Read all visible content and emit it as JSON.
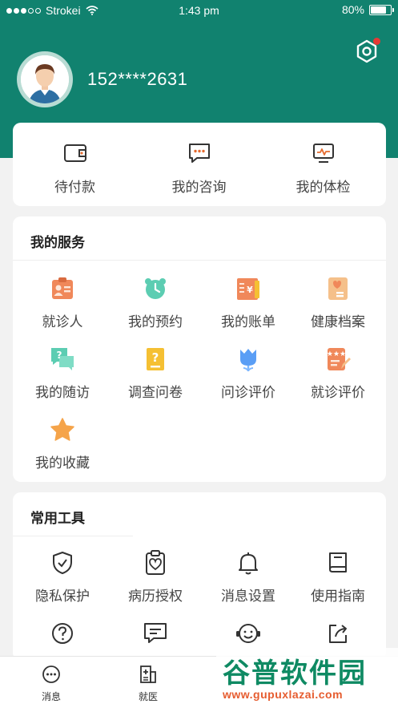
{
  "status_bar": {
    "carrier": "Strokei",
    "time": "1:43 pm",
    "battery": "80%",
    "battery_level": 0.8
  },
  "profile": {
    "phone": "152****2631"
  },
  "quick_actions": [
    {
      "label": "待付款",
      "icon": "wallet-icon"
    },
    {
      "label": "我的咨询",
      "icon": "chat-bubble-icon"
    },
    {
      "label": "我的体检",
      "icon": "monitor-pulse-icon"
    }
  ],
  "services": {
    "title": "我的服务",
    "items": [
      {
        "label": "就诊人",
        "icon": "id-card-icon"
      },
      {
        "label": "我的预约",
        "icon": "alarm-clock-icon"
      },
      {
        "label": "我的账单",
        "icon": "bill-icon"
      },
      {
        "label": "健康档案",
        "icon": "health-file-icon"
      },
      {
        "label": "我的随访",
        "icon": "question-chat-icon"
      },
      {
        "label": "调查问卷",
        "icon": "survey-icon"
      },
      {
        "label": "问诊评价",
        "icon": "tulip-icon"
      },
      {
        "label": "就诊评价",
        "icon": "review-pen-icon"
      },
      {
        "label": "我的收藏",
        "icon": "star-icon"
      }
    ]
  },
  "tools": {
    "title": "常用工具",
    "items": [
      {
        "label": "隐私保护",
        "icon": "shield-check-icon"
      },
      {
        "label": "病历授权",
        "icon": "clipboard-heart-icon"
      },
      {
        "label": "消息设置",
        "icon": "bell-icon"
      },
      {
        "label": "使用指南",
        "icon": "book-icon"
      },
      {
        "label": "",
        "icon": "help-circle-icon"
      },
      {
        "label": "",
        "icon": "message-square-icon"
      },
      {
        "label": "",
        "icon": "smile-headset-icon"
      },
      {
        "label": "",
        "icon": "share-icon"
      }
    ]
  },
  "tabbar": [
    {
      "label": "消息",
      "icon": "message-dots-icon"
    },
    {
      "label": "就医",
      "icon": "hospital-icon"
    }
  ],
  "watermark": {
    "title": "谷普软件园",
    "url": "www.gupuxlazai.com"
  },
  "colors": {
    "brand": "#11826f",
    "accent_orange": "#f0885a",
    "teal_light": "#5ccdb2",
    "yellow": "#f5c033",
    "badge_red": "#e53935"
  }
}
